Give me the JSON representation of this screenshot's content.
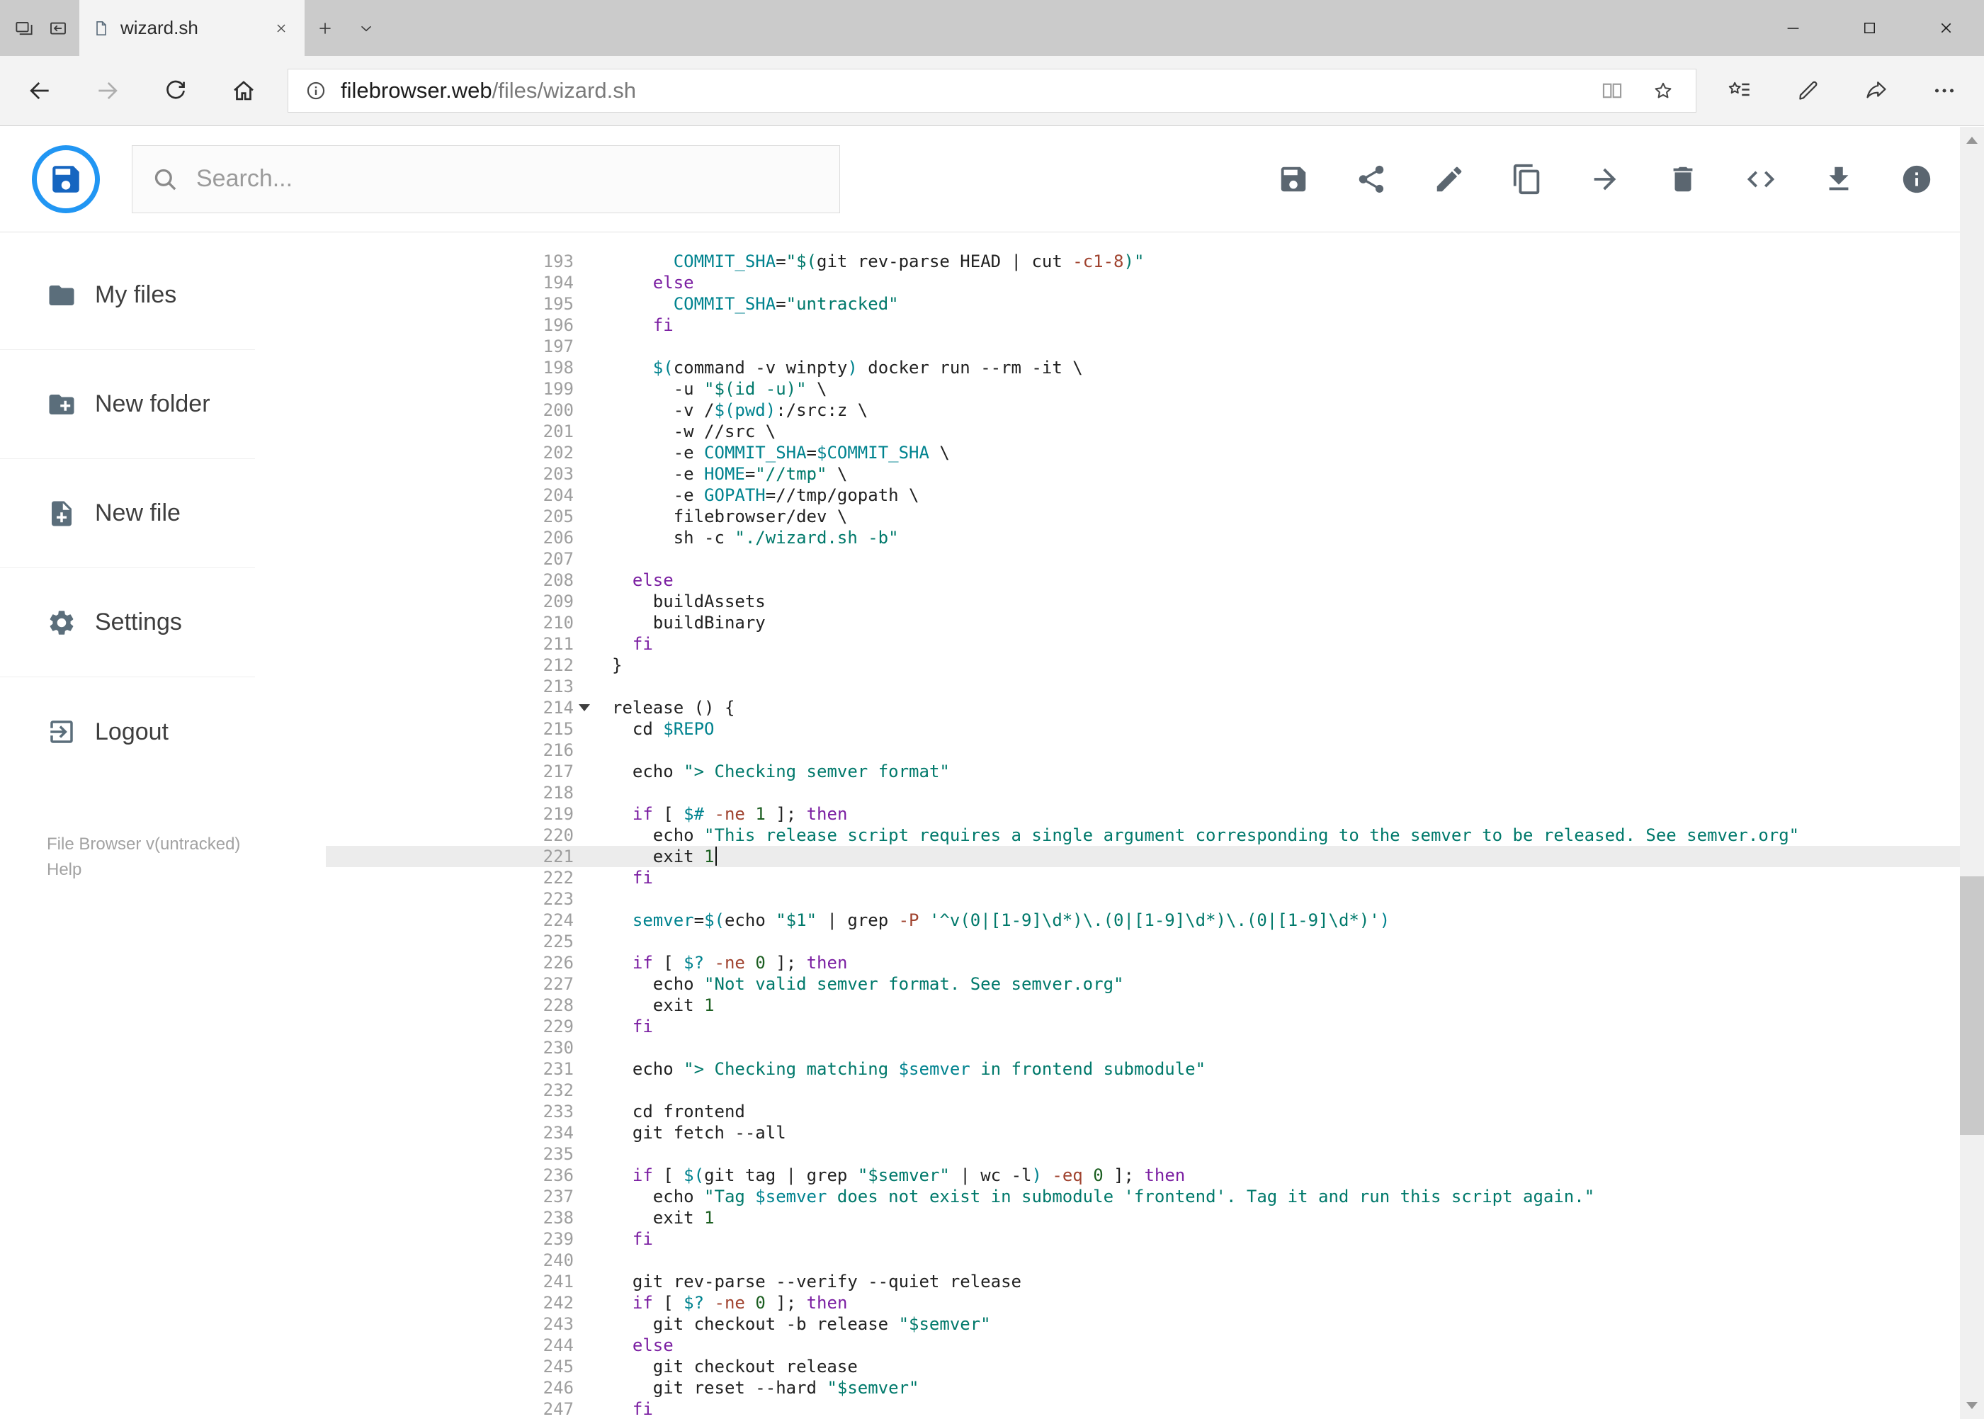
{
  "brand": {
    "logo_icon": "save-icon",
    "logo_blue": "#1565c0",
    "logo_ring": "#2196f3"
  },
  "browser": {
    "titlebar_left_icons": [
      "tabs-preview-icon",
      "set-tabs-aside-icon"
    ],
    "tab": {
      "title": "wizard.sh",
      "favicon_icon": "page-icon",
      "close_icon": "close-icon"
    },
    "new_tab_icon": "plus-icon",
    "tab_list_icon": "chevron-down-icon",
    "window_controls": [
      "minimize-icon",
      "maximize-icon",
      "close-icon"
    ],
    "nav_left_icons": [
      "back-icon",
      "forward-icon",
      "refresh-icon",
      "home-icon"
    ],
    "address": {
      "info_icon": "page-info-icon",
      "url_host": "filebrowser.web",
      "url_path": "/files/wizard.sh",
      "right_icons": [
        "reading-view-icon",
        "star-icon"
      ]
    },
    "nav_right_icons": [
      "hub-icon",
      "annotate-icon",
      "share-page-icon",
      "more-icon"
    ]
  },
  "toolbar": {
    "search_icon": "search-icon",
    "search_placeholder": "Search...",
    "actions": [
      {
        "icon": "save-icon"
      },
      {
        "icon": "share-icon"
      },
      {
        "icon": "edit-icon"
      },
      {
        "icon": "copy-icon"
      },
      {
        "icon": "move-icon"
      },
      {
        "icon": "delete-icon"
      },
      {
        "icon": "code-icon"
      },
      {
        "icon": "download-icon"
      },
      {
        "icon": "info-icon"
      }
    ]
  },
  "sidebar": {
    "items": [
      {
        "label": "My files",
        "icon": "folder-icon"
      },
      {
        "label": "New folder",
        "icon": "new-folder-icon"
      },
      {
        "label": "New file",
        "icon": "new-file-icon"
      },
      {
        "label": "Settings",
        "icon": "settings-icon"
      },
      {
        "label": "Logout",
        "icon": "logout-icon"
      }
    ],
    "footer_version": "File Browser v(untracked)",
    "footer_help": "Help"
  },
  "editor": {
    "active_line": 221,
    "fold_marker_line": 214,
    "colors": {
      "default": "#212121",
      "keyword": "#7b1fa2",
      "string": "#00796b",
      "variable": "#00838f",
      "flag": "#a0432f",
      "number": "#1b5e20",
      "line_number": "#9e9e9e",
      "active_line_bg": "#ececec"
    },
    "lines": [
      {
        "n": 193,
        "t": [
          [
            "d",
            "      "
          ],
          [
            "v",
            "COMMIT_SHA"
          ],
          [
            "d",
            "="
          ],
          [
            "s",
            "\"$("
          ],
          [
            "d",
            "git rev-parse HEAD | cut "
          ],
          [
            "f",
            "-c1-8"
          ],
          [
            "s",
            ")\""
          ]
        ]
      },
      {
        "n": 194,
        "t": [
          [
            "d",
            "    "
          ],
          [
            "k",
            "else"
          ]
        ]
      },
      {
        "n": 195,
        "t": [
          [
            "d",
            "      "
          ],
          [
            "v",
            "COMMIT_SHA"
          ],
          [
            "d",
            "="
          ],
          [
            "s",
            "\"untracked\""
          ]
        ]
      },
      {
        "n": 196,
        "t": [
          [
            "d",
            "    "
          ],
          [
            "k",
            "fi"
          ]
        ]
      },
      {
        "n": 197,
        "t": []
      },
      {
        "n": 198,
        "t": [
          [
            "d",
            "    "
          ],
          [
            "v",
            "$("
          ],
          [
            "d",
            "command -v winpty"
          ],
          [
            "v",
            ")"
          ],
          [
            "d",
            " docker run --rm -it \\"
          ]
        ]
      },
      {
        "n": 199,
        "t": [
          [
            "d",
            "      -u "
          ],
          [
            "s",
            "\"$(id -u)\""
          ],
          [
            "d",
            " \\"
          ]
        ]
      },
      {
        "n": 200,
        "t": [
          [
            "d",
            "      -v /"
          ],
          [
            "v",
            "$(pwd)"
          ],
          [
            "d",
            ":/src:z \\"
          ]
        ]
      },
      {
        "n": 201,
        "t": [
          [
            "d",
            "      -w //src \\"
          ]
        ]
      },
      {
        "n": 202,
        "t": [
          [
            "d",
            "      -e "
          ],
          [
            "v",
            "COMMIT_SHA"
          ],
          [
            "d",
            "="
          ],
          [
            "v",
            "$COMMIT_SHA"
          ],
          [
            "d",
            " \\"
          ]
        ]
      },
      {
        "n": 203,
        "t": [
          [
            "d",
            "      -e "
          ],
          [
            "v",
            "HOME"
          ],
          [
            "d",
            "="
          ],
          [
            "s",
            "\"//tmp\""
          ],
          [
            "d",
            " \\"
          ]
        ]
      },
      {
        "n": 204,
        "t": [
          [
            "d",
            "      -e "
          ],
          [
            "v",
            "GOPATH"
          ],
          [
            "d",
            "=//tmp/gopath \\"
          ]
        ]
      },
      {
        "n": 205,
        "t": [
          [
            "d",
            "      filebrowser/dev \\"
          ]
        ]
      },
      {
        "n": 206,
        "t": [
          [
            "d",
            "      sh -c "
          ],
          [
            "s",
            "\"./wizard.sh -b\""
          ]
        ]
      },
      {
        "n": 207,
        "t": []
      },
      {
        "n": 208,
        "t": [
          [
            "d",
            "  "
          ],
          [
            "k",
            "else"
          ]
        ]
      },
      {
        "n": 209,
        "t": [
          [
            "d",
            "    buildAssets"
          ]
        ]
      },
      {
        "n": 210,
        "t": [
          [
            "d",
            "    build"
          ],
          [
            "d",
            "Binary"
          ]
        ]
      },
      {
        "n": 211,
        "t": [
          [
            "d",
            "  "
          ],
          [
            "k",
            "fi"
          ]
        ]
      },
      {
        "n": 212,
        "t": [
          [
            "d",
            "}"
          ]
        ]
      },
      {
        "n": 213,
        "t": []
      },
      {
        "n": 214,
        "t": [
          [
            "d",
            "release () {"
          ]
        ]
      },
      {
        "n": 215,
        "t": [
          [
            "d",
            "  cd "
          ],
          [
            "v",
            "$REPO"
          ]
        ]
      },
      {
        "n": 216,
        "t": []
      },
      {
        "n": 217,
        "t": [
          [
            "d",
            "  echo "
          ],
          [
            "s",
            "\"> Checking semver format\""
          ]
        ]
      },
      {
        "n": 218,
        "t": []
      },
      {
        "n": 219,
        "t": [
          [
            "d",
            "  "
          ],
          [
            "k",
            "if"
          ],
          [
            "d",
            " [ "
          ],
          [
            "v",
            "$#"
          ],
          [
            "d",
            " "
          ],
          [
            "f",
            "-ne"
          ],
          [
            "d",
            " "
          ],
          [
            "m",
            "1"
          ],
          [
            "d",
            " ]; "
          ],
          [
            "k",
            "then"
          ]
        ]
      },
      {
        "n": 220,
        "t": [
          [
            "d",
            "    echo "
          ],
          [
            "s",
            "\"This release script requires a single argument corresponding to the semver to be released. See semver.org\""
          ]
        ]
      },
      {
        "n": 221,
        "t": [
          [
            "d",
            "    exit "
          ],
          [
            "m",
            "1"
          ]
        ]
      },
      {
        "n": 222,
        "t": [
          [
            "d",
            "  "
          ],
          [
            "k",
            "fi"
          ]
        ]
      },
      {
        "n": 223,
        "t": []
      },
      {
        "n": 224,
        "t": [
          [
            "d",
            "  "
          ],
          [
            "v",
            "semver"
          ],
          [
            "d",
            "="
          ],
          [
            "v",
            "$("
          ],
          [
            "d",
            "echo "
          ],
          [
            "s",
            "\"$1\""
          ],
          [
            "d",
            " | grep "
          ],
          [
            "f",
            "-P"
          ],
          [
            "d",
            " "
          ],
          [
            "s",
            "'^v(0|[1-9]\\d*)\\.(0|[1-9]\\d*)\\.(0|[1-9]\\d*)'"
          ],
          [
            "v",
            ")"
          ]
        ]
      },
      {
        "n": 225,
        "t": []
      },
      {
        "n": 226,
        "t": [
          [
            "d",
            "  "
          ],
          [
            "k",
            "if"
          ],
          [
            "d",
            " [ "
          ],
          [
            "v",
            "$?"
          ],
          [
            "d",
            " "
          ],
          [
            "f",
            "-ne"
          ],
          [
            "d",
            " "
          ],
          [
            "m",
            "0"
          ],
          [
            "d",
            " ]; "
          ],
          [
            "k",
            "then"
          ]
        ]
      },
      {
        "n": 227,
        "t": [
          [
            "d",
            "    echo "
          ],
          [
            "s",
            "\"Not valid semver format. See semver.org\""
          ]
        ]
      },
      {
        "n": 228,
        "t": [
          [
            "d",
            "    exit "
          ],
          [
            "m",
            "1"
          ]
        ]
      },
      {
        "n": 229,
        "t": [
          [
            "d",
            "  "
          ],
          [
            "k",
            "fi"
          ]
        ]
      },
      {
        "n": 230,
        "t": []
      },
      {
        "n": 231,
        "t": [
          [
            "d",
            "  echo "
          ],
          [
            "s",
            "\"> Checking matching "
          ],
          [
            "v",
            "$semver"
          ],
          [
            "s",
            " in frontend submodule\""
          ]
        ]
      },
      {
        "n": 232,
        "t": []
      },
      {
        "n": 233,
        "t": [
          [
            "d",
            "  cd frontend"
          ]
        ]
      },
      {
        "n": 234,
        "t": [
          [
            "d",
            "  git fetch --all"
          ]
        ]
      },
      {
        "n": 235,
        "t": []
      },
      {
        "n": 236,
        "t": [
          [
            "d",
            "  "
          ],
          [
            "k",
            "if"
          ],
          [
            "d",
            " [ "
          ],
          [
            "v",
            "$("
          ],
          [
            "d",
            "git tag | grep "
          ],
          [
            "s",
            "\"$semver\""
          ],
          [
            "d",
            " | wc -l"
          ],
          [
            "v",
            ")"
          ],
          [
            "d",
            " "
          ],
          [
            "f",
            "-eq"
          ],
          [
            "d",
            " "
          ],
          [
            "m",
            "0"
          ],
          [
            "d",
            " ]; "
          ],
          [
            "k",
            "then"
          ]
        ]
      },
      {
        "n": 237,
        "t": [
          [
            "d",
            "    echo "
          ],
          [
            "s",
            "\"Tag "
          ],
          [
            "v",
            "$semver"
          ],
          [
            "s",
            " does not exist in submodule 'frontend'. Tag it and run this script again.\""
          ]
        ]
      },
      {
        "n": 238,
        "t": [
          [
            "d",
            "    exit "
          ],
          [
            "m",
            "1"
          ]
        ]
      },
      {
        "n": 239,
        "t": [
          [
            "d",
            "  "
          ],
          [
            "k",
            "fi"
          ]
        ]
      },
      {
        "n": 240,
        "t": []
      },
      {
        "n": 241,
        "t": [
          [
            "d",
            "  git rev-parse --verify --quiet release"
          ]
        ]
      },
      {
        "n": 242,
        "t": [
          [
            "d",
            "  "
          ],
          [
            "k",
            "if"
          ],
          [
            "d",
            " [ "
          ],
          [
            "v",
            "$?"
          ],
          [
            "d",
            " "
          ],
          [
            "f",
            "-ne"
          ],
          [
            "d",
            " "
          ],
          [
            "m",
            "0"
          ],
          [
            "d",
            " ]; "
          ],
          [
            "k",
            "then"
          ]
        ]
      },
      {
        "n": 243,
        "t": [
          [
            "d",
            "    git checkout -b release "
          ],
          [
            "s",
            "\"$semver\""
          ]
        ]
      },
      {
        "n": 244,
        "t": [
          [
            "d",
            "  "
          ],
          [
            "k",
            "else"
          ]
        ]
      },
      {
        "n": 245,
        "t": [
          [
            "d",
            "    git checkout release"
          ]
        ]
      },
      {
        "n": 246,
        "t": [
          [
            "d",
            "    git reset --hard "
          ],
          [
            "s",
            "\"$semver\""
          ]
        ]
      },
      {
        "n": 247,
        "t": [
          [
            "d",
            "  "
          ],
          [
            "k",
            "fi"
          ]
        ]
      }
    ]
  }
}
